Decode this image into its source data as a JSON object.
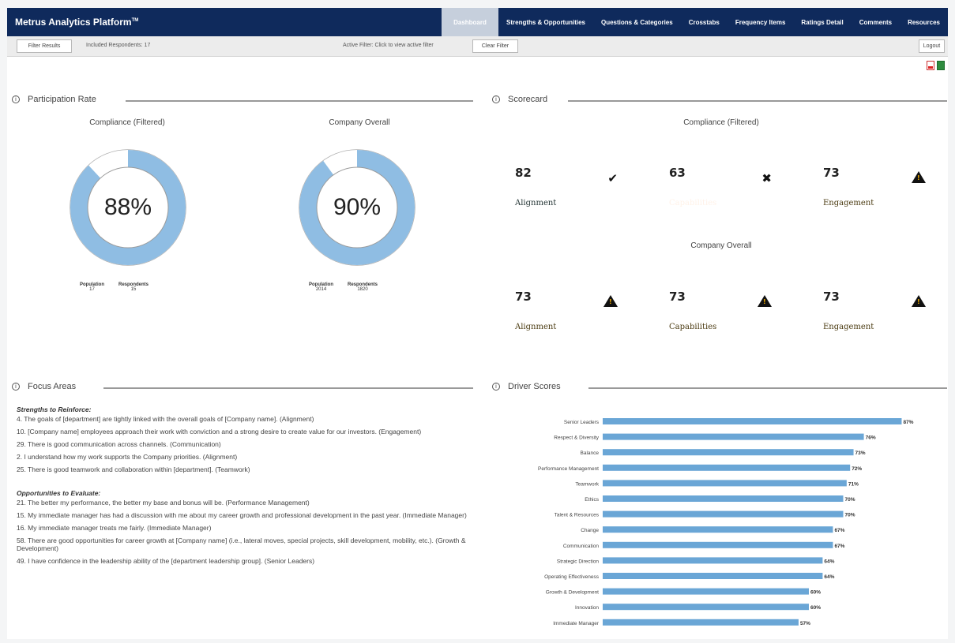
{
  "app": {
    "title": "Metrus Analytics Platform",
    "tm": "TM"
  },
  "nav": {
    "items": [
      "Dashboard",
      "Strengths & Opportunities",
      "Questions & Categories",
      "Crosstabs",
      "Frequency Items",
      "Ratings Detail",
      "Comments",
      "Resources"
    ],
    "active_index": 0
  },
  "subbar": {
    "filter_button": "Filter Results",
    "included_respondents": "Included Respondents: 17",
    "active_filter": "Active Filter: Click to view active filter",
    "clear_filter": "Clear Filter",
    "logout": "Logout"
  },
  "participation": {
    "header": "Participation Rate",
    "charts": [
      {
        "title": "Compliance (Filtered)",
        "percent_label": "88%",
        "percent": 88,
        "population_label": "Population",
        "population": "17",
        "respondents_label": "Respondents",
        "respondents": "15"
      },
      {
        "title": "Company Overall",
        "percent_label": "90%",
        "percent": 90,
        "population_label": "Population",
        "population": "2014",
        "respondents_label": "Respondents",
        "respondents": "1820"
      }
    ],
    "fill_color": "#8fbde3",
    "empty_color": "#ffffff"
  },
  "scorecard": {
    "header": "Scorecard",
    "group1_title": "Compliance (Filtered)",
    "group2_title": "Company Overall",
    "group1": [
      {
        "score": "82",
        "label": "Alignment",
        "status": "good",
        "icon": "check-icon",
        "color": "#5a9432"
      },
      {
        "score": "63",
        "label": "Capabilities",
        "status": "bad",
        "icon": "x-icon",
        "color": "#f03c17"
      },
      {
        "score": "73",
        "label": "Engagement",
        "status": "warn",
        "icon": "warning-icon",
        "color": "#f7b000"
      }
    ],
    "group2": [
      {
        "score": "73",
        "label": "Alignment",
        "status": "warn",
        "icon": "warning-icon",
        "color": "#f7b000"
      },
      {
        "score": "73",
        "label": "Capabilities",
        "status": "warn",
        "icon": "warning-icon",
        "color": "#f7b000"
      },
      {
        "score": "73",
        "label": "Engagement",
        "status": "warn",
        "icon": "warning-icon",
        "color": "#f7b000"
      }
    ]
  },
  "focus": {
    "header": "Focus Areas",
    "strengths_title": "Strengths to Reinforce:",
    "strengths": [
      "4. The goals of [department] are tightly linked with the overall goals of [Company name]. (Alignment)",
      "10. [Company name] employees approach their work with conviction and a strong desire to create value for our investors. (Engagement)",
      "29. There is good communication across channels. (Communication)",
      "2. I understand how my work supports the Company priorities. (Alignment)",
      "25. There is good teamwork and collaboration within [department]. (Teamwork)"
    ],
    "opportunities_title": "Opportunities to Evaluate:",
    "opportunities": [
      "21. The better my performance, the better my base and bonus will be. (Performance Management)",
      "15. My immediate manager has had a discussion with me about my career growth and professional development in the past year. (Immediate Manager)",
      "16. My immediate manager treats me fairly. (Immediate Manager)",
      "58. There are good opportunities for career growth at [Company name] (i.e., lateral moves, special projects, skill development, mobility, etc.). (Growth & Development)",
      "49. I have confidence in the leadership ability of the [department leadership group]. (Senior Leaders)"
    ]
  },
  "driver": {
    "header": "Driver Scores"
  },
  "chart_data": {
    "type": "bar",
    "orientation": "horizontal",
    "categories": [
      "Senior Leaders",
      "Respect & Diversity",
      "Balance",
      "Performance Management",
      "Teamwork",
      "Ethics",
      "Talent & Resources",
      "Change",
      "Communication",
      "Strategic Direction",
      "Operating Effectiveness",
      "Growth & Development",
      "Innovation",
      "Immediate Manager"
    ],
    "values": [
      87,
      76,
      73,
      72,
      71,
      70,
      70,
      67,
      67,
      64,
      64,
      60,
      60,
      57
    ],
    "value_labels": [
      "87%",
      "76%",
      "73%",
      "72%",
      "71%",
      "70%",
      "70%",
      "67%",
      "67%",
      "64%",
      "64%",
      "60%",
      "60%",
      "57%"
    ],
    "xlim": [
      0,
      100
    ],
    "bar_color": "#6aa6d6",
    "grid": false,
    "title": ""
  }
}
